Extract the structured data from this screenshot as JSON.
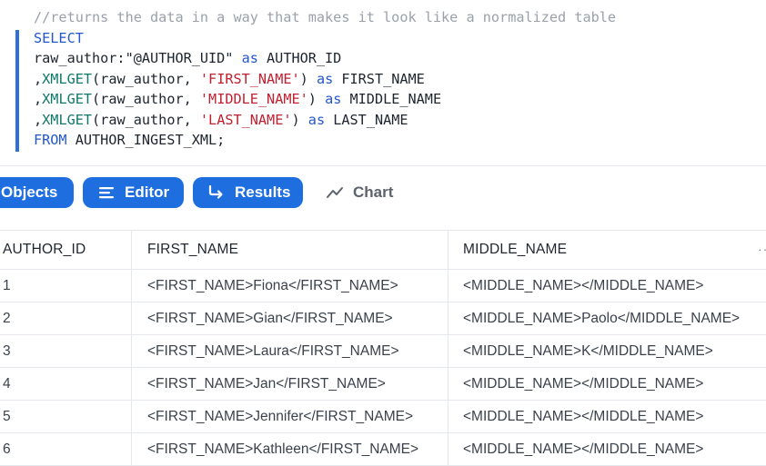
{
  "editor": {
    "lines": [
      [
        {
          "t": "//returns the data in a way that makes it look like a normalized table",
          "c": "comment"
        }
      ],
      [
        {
          "t": "SELECT",
          "c": "kw"
        }
      ],
      [
        {
          "t": "raw_author:\"@AUTHOR_UID\" ",
          "c": "plain"
        },
        {
          "t": "as",
          "c": "kw"
        },
        {
          "t": " AUTHOR_ID",
          "c": "plain"
        }
      ],
      [
        {
          "t": ",",
          "c": "plain"
        },
        {
          "t": "XMLGET",
          "c": "fn"
        },
        {
          "t": "(raw_author, ",
          "c": "plain"
        },
        {
          "t": "'FIRST_NAME'",
          "c": "str"
        },
        {
          "t": ") ",
          "c": "plain"
        },
        {
          "t": "as",
          "c": "kw"
        },
        {
          "t": " FIRST_NAME",
          "c": "plain"
        }
      ],
      [
        {
          "t": ",",
          "c": "plain"
        },
        {
          "t": "XMLGET",
          "c": "fn"
        },
        {
          "t": "(raw_author, ",
          "c": "plain"
        },
        {
          "t": "'MIDDLE_NAME'",
          "c": "str"
        },
        {
          "t": ") ",
          "c": "plain"
        },
        {
          "t": "as",
          "c": "kw"
        },
        {
          "t": " MIDDLE_NAME",
          "c": "plain"
        }
      ],
      [
        {
          "t": ",",
          "c": "plain"
        },
        {
          "t": "XMLGET",
          "c": "fn"
        },
        {
          "t": "(raw_author, ",
          "c": "plain"
        },
        {
          "t": "'LAST_NAME'",
          "c": "str"
        },
        {
          "t": ") ",
          "c": "plain"
        },
        {
          "t": "as",
          "c": "kw"
        },
        {
          "t": " LAST_NAME",
          "c": "plain"
        }
      ],
      [
        {
          "t": "FROM",
          "c": "kw"
        },
        {
          "t": " AUTHOR_INGEST_XML;",
          "c": "plain"
        }
      ]
    ]
  },
  "toolbar": {
    "objects_label": "Objects",
    "editor_label": "Editor",
    "results_label": "Results",
    "chart_label": "Chart",
    "icons": {
      "editor": "list-icon",
      "results": "arrow-turn-right-icon",
      "chart": "line-chart-icon"
    },
    "accent_color": "#1f6ee0"
  },
  "results": {
    "columns": [
      "AUTHOR_ID",
      "FIRST_NAME",
      "MIDDLE_NAME"
    ],
    "more_label": "···",
    "rows": [
      [
        "1",
        "<FIRST_NAME>Fiona</FIRST_NAME>",
        "<MIDDLE_NAME></MIDDLE_NAME>"
      ],
      [
        "2",
        "<FIRST_NAME>Gian</FIRST_NAME>",
        "<MIDDLE_NAME>Paolo</MIDDLE_NAME>"
      ],
      [
        "3",
        "<FIRST_NAME>Laura</FIRST_NAME>",
        "<MIDDLE_NAME>K</MIDDLE_NAME>"
      ],
      [
        "4",
        "<FIRST_NAME>Jan</FIRST_NAME>",
        "<MIDDLE_NAME></MIDDLE_NAME>"
      ],
      [
        "5",
        "<FIRST_NAME>Jennifer</FIRST_NAME>",
        "<MIDDLE_NAME></MIDDLE_NAME>"
      ],
      [
        "6",
        "<FIRST_NAME>Kathleen</FIRST_NAME>",
        "<MIDDLE_NAME></MIDDLE_NAME>"
      ]
    ]
  }
}
